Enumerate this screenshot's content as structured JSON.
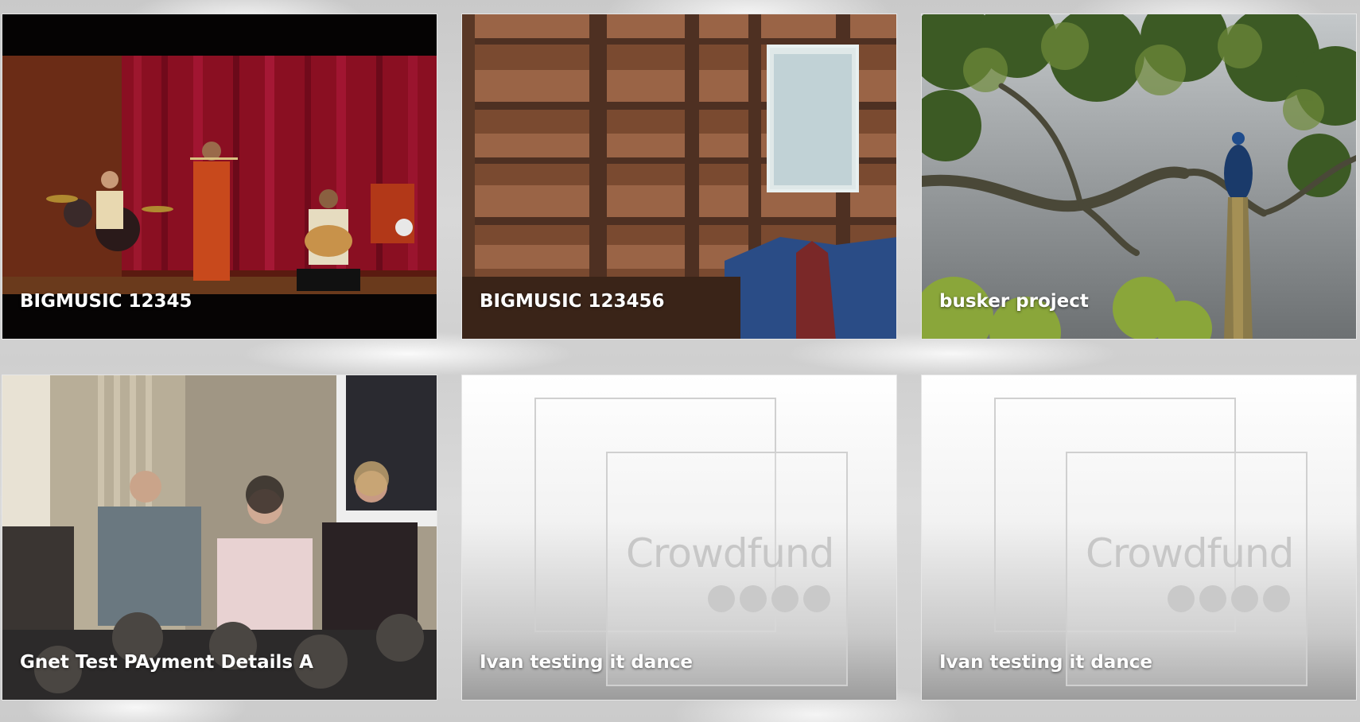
{
  "projects": [
    {
      "title": "BIGMUSIC 12345",
      "thumbnail": "concert-stage-photo"
    },
    {
      "title": "BIGMUSIC 123456",
      "thumbnail": "wooden-barn-wall-photo"
    },
    {
      "title": "busker project",
      "thumbnail": "peacock-in-tree-photo"
    },
    {
      "title": "Gnet Test PAyment Details A",
      "thumbnail": "three-women-speaking-photo"
    },
    {
      "title": "Ivan testing it dance",
      "thumbnail": "crowdfund-placeholder",
      "placeholder_text": "Crowdfund"
    },
    {
      "title": "Ivan testing it dance",
      "thumbnail": "crowdfund-placeholder",
      "placeholder_text": "Crowdfund"
    }
  ],
  "colors": {
    "title_text": "#ffffff",
    "placeholder_logo": "#c7c7c7",
    "background": "#d2d2d2"
  }
}
